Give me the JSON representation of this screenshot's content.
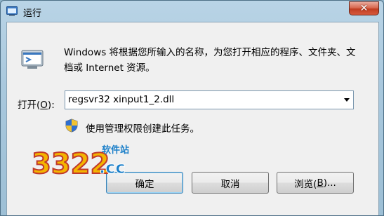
{
  "window": {
    "title": "运行",
    "close_label": "✕"
  },
  "description": "Windows 将根据您所输入的名称，为您打开相应的程序、文件夹、文档或 Internet 资源。",
  "open": {
    "label_prefix": "打开(",
    "label_accel": "O",
    "label_suffix": "):",
    "value": "regsvr32 xinput1_2.dll"
  },
  "admin_note": "使用管理权限创建此任务。",
  "buttons": {
    "ok": "确定",
    "cancel": "取消",
    "browse_prefix": "浏览(",
    "browse_accel": "B",
    "browse_suffix": ")..."
  },
  "watermark": {
    "number": "3322",
    "domain": ".cc",
    "tag": "软件站"
  }
}
